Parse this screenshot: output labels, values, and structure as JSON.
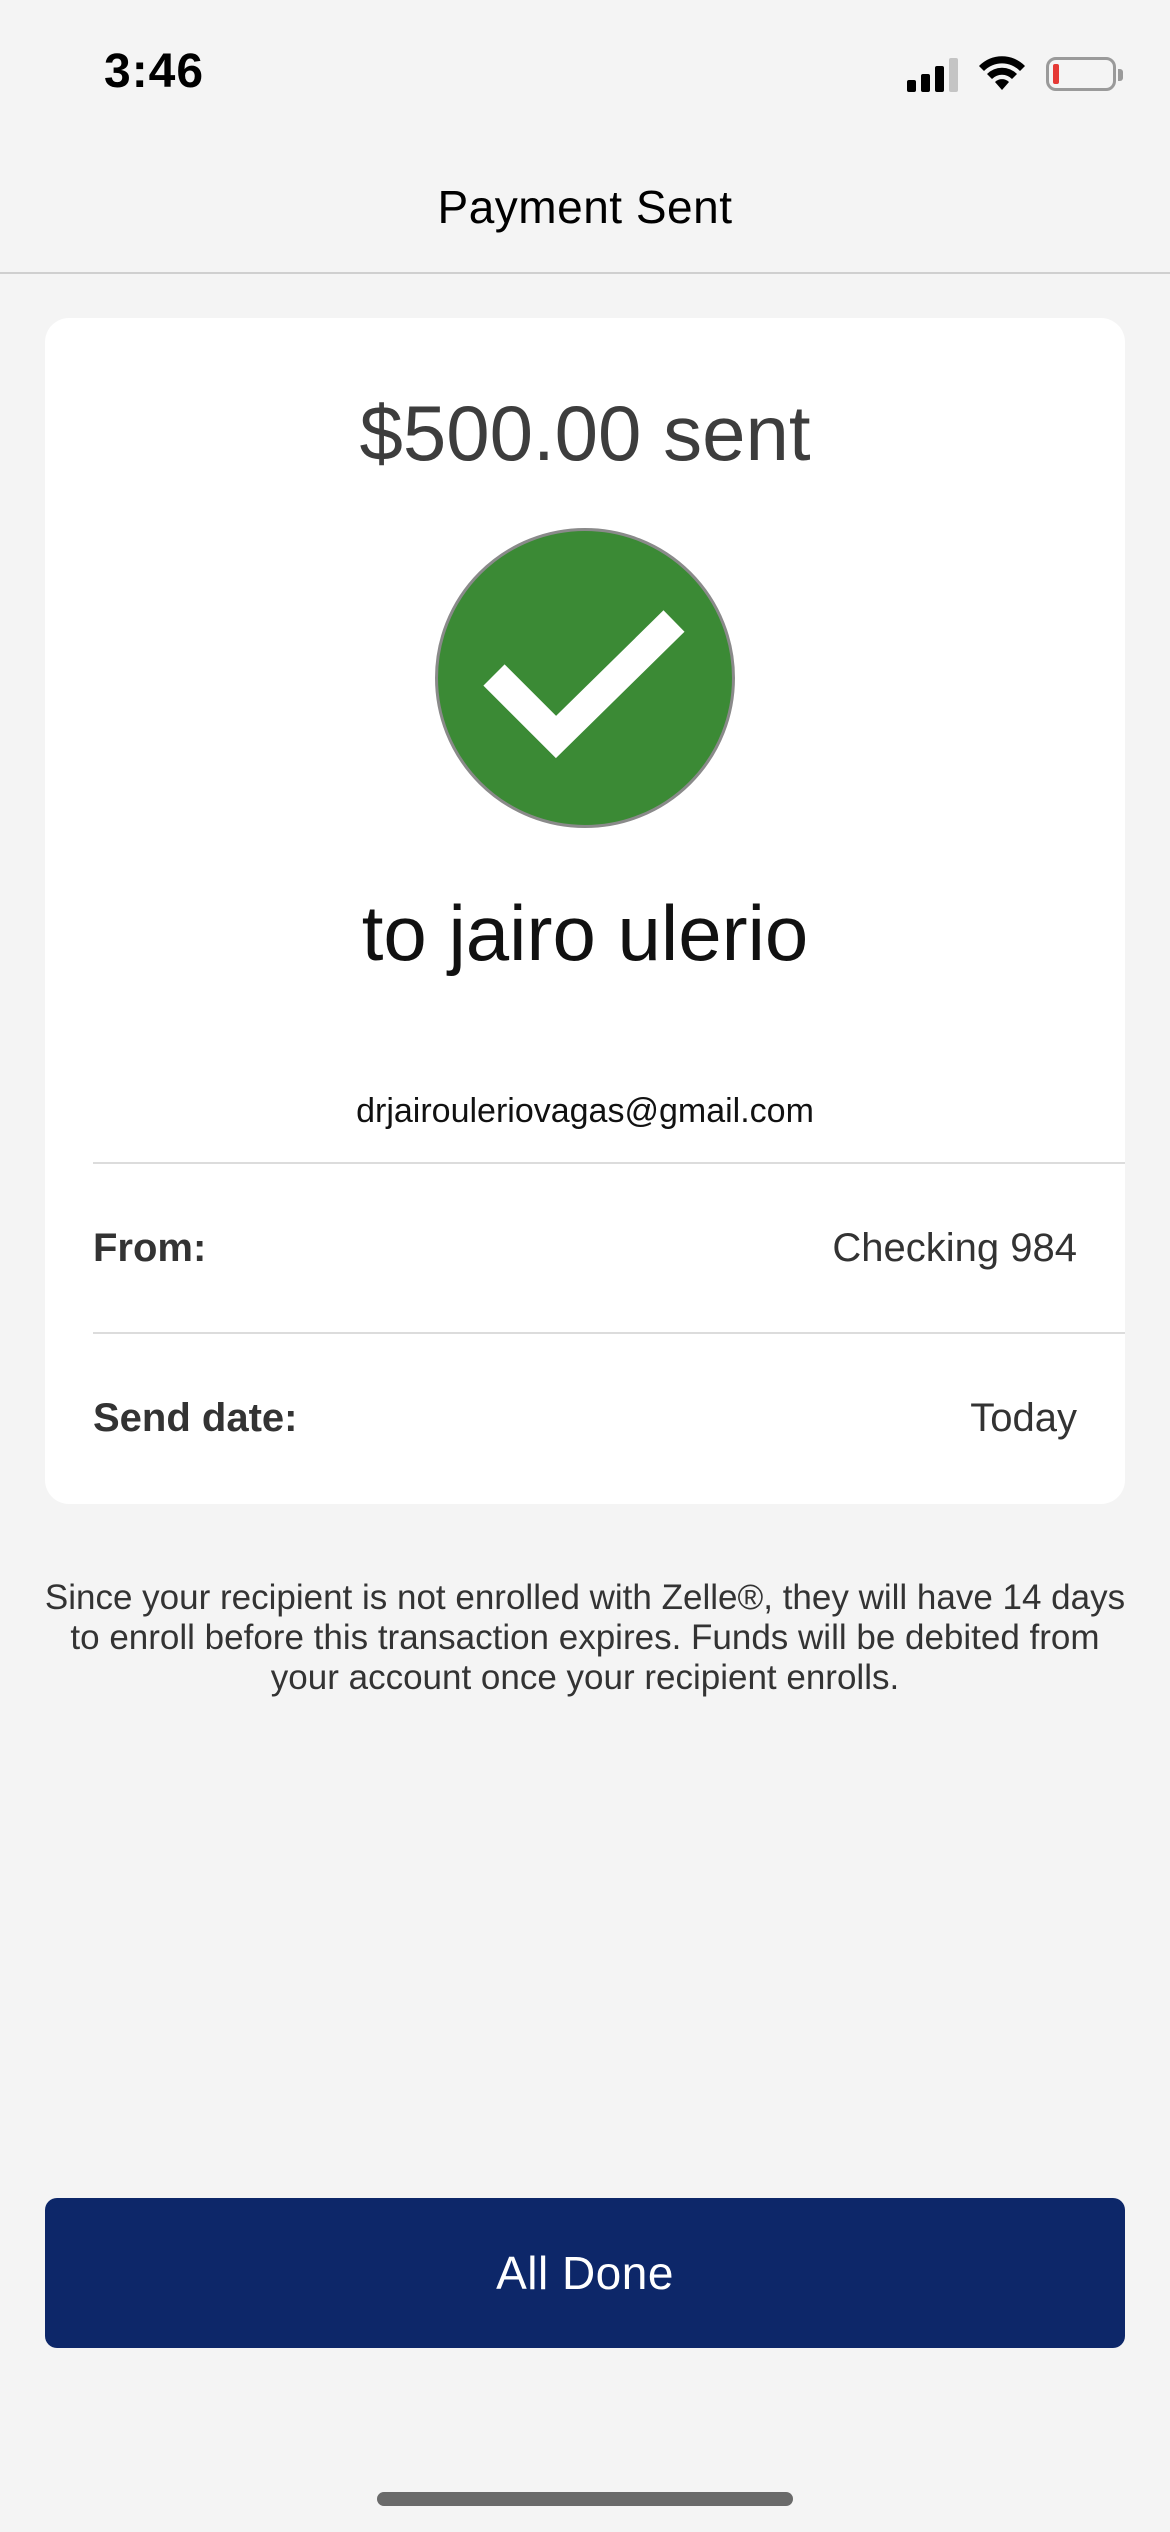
{
  "status_bar": {
    "time": "3:46",
    "icons": [
      "signal-icon",
      "wifi-icon",
      "battery-icon"
    ],
    "battery_color": "#e53935"
  },
  "header": {
    "title": "Payment Sent"
  },
  "payment": {
    "amount_text": "$500.00 sent",
    "recipient_text": "to jairo ulerio",
    "recipient_email": "drjairouleriovagas@gmail.com",
    "status_icon": "checkmark-icon",
    "status_color": "#3b8a35"
  },
  "details": {
    "from_label": "From:",
    "from_value": "Checking 984",
    "date_label": "Send date:",
    "date_value": "Today"
  },
  "notice": {
    "text": "Since your recipient is not enrolled with Zelle®, they will have 14 days to enroll before this transaction expires. Funds will be debited from your account once your recipient enrolls."
  },
  "actions": {
    "done_label": "All Done",
    "done_color": "#0d2769"
  }
}
